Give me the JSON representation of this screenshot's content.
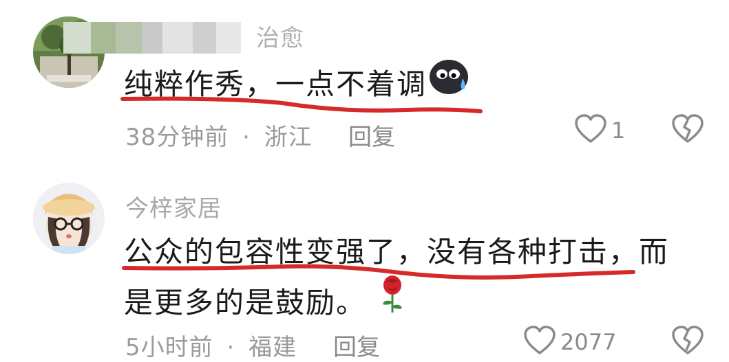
{
  "comments": [
    {
      "username_visible": "治愈",
      "text": "纯粹作秀，一点不着调",
      "emoji_icon": "sweat-face-icon",
      "time": "38分钟前",
      "location": "浙江",
      "meta_separator": "·",
      "reply_label": "回复",
      "like_count": "1"
    },
    {
      "username_visible": "今梓家居",
      "text_line1": "公众的包容性变强了，没有各种打击，而",
      "text_line2": "是更多的是鼓励。",
      "emoji_icon": "rose-icon",
      "time": "5小时前",
      "location": "福建",
      "meta_separator": "·",
      "reply_label": "回复",
      "like_count": "2077"
    }
  ],
  "colors": {
    "underline": "#d62a2a",
    "meta_text": "#9a9a9a",
    "body_text": "#1a1a1a"
  }
}
